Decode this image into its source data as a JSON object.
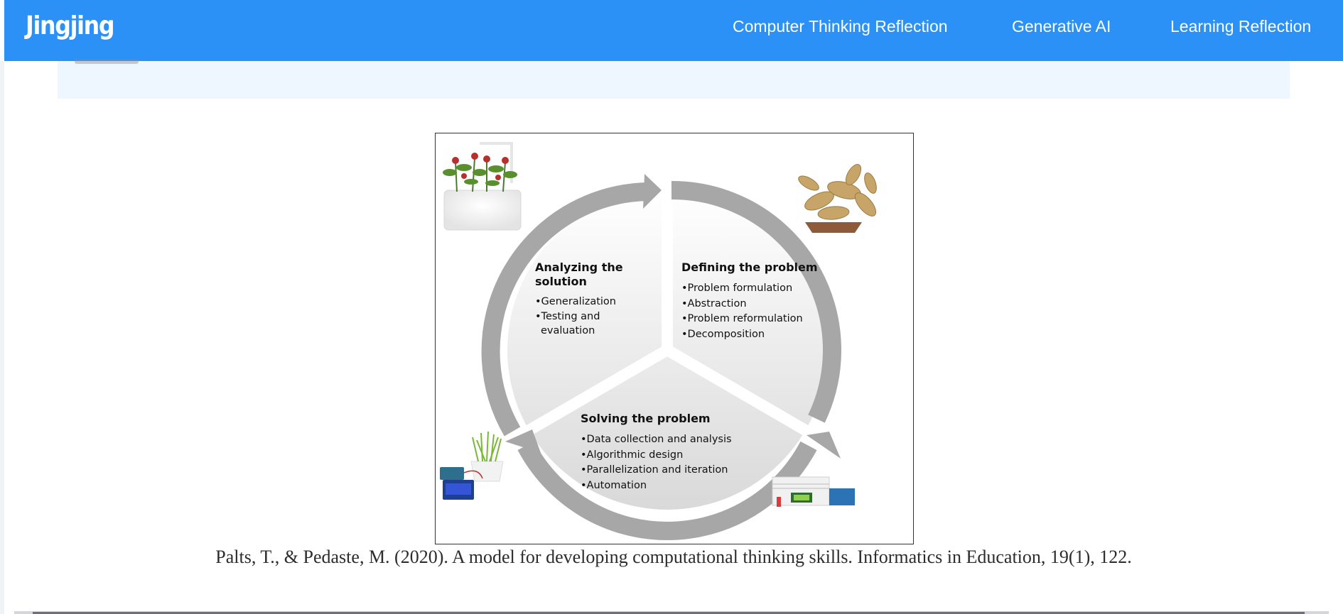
{
  "nav": {
    "brand": "Jingjing",
    "links": [
      "Computer Thinking Reflection",
      "Generative AI",
      "Learning Reflection"
    ]
  },
  "figure": {
    "sections": {
      "analyzing": {
        "title": [
          "Analyzing the",
          "solution"
        ],
        "items": [
          "•Generalization",
          "•Testing and",
          "evaluation"
        ]
      },
      "defining": {
        "title": [
          "Defining the problem"
        ],
        "items": [
          "•Problem formulation",
          "•Abstraction",
          "•Problem reformulation",
          "•Decomposition"
        ]
      },
      "solving": {
        "title": [
          "Solving the problem"
        ],
        "items": [
          "•Data collection and analysis",
          "•Algorithmic design",
          "•Parallelization and iteration",
          "•Automation"
        ]
      }
    },
    "colors": {
      "arrow": "#a7a7a7",
      "center_fade": "#d9d9d9"
    }
  },
  "caption": "Palts, T., & Pedaste, M. (2020). A model for developing computational thinking skills. Informatics in Education, 19(1), 122."
}
